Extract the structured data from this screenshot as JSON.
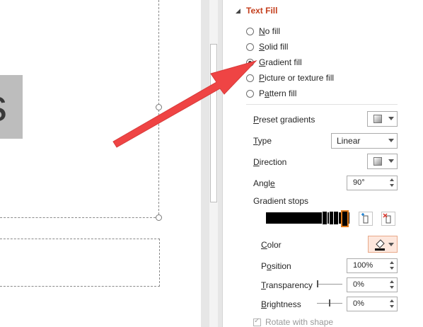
{
  "slide": {
    "partial_text": "s"
  },
  "pane": {
    "section_title": "Text Fill",
    "fill_options": [
      {
        "label": "No fill",
        "accel": "N",
        "selected": false
      },
      {
        "label": "Solid fill",
        "accel": "S",
        "selected": false
      },
      {
        "label": "Gradient fill",
        "accel": "G",
        "selected": true
      },
      {
        "label": "Picture or texture fill",
        "accel": "P",
        "selected": false
      },
      {
        "label": "Pattern fill",
        "accel": "a",
        "selected": false
      }
    ],
    "preset_gradients_label": "Preset gradients",
    "type_label": "Type",
    "type_value": "Linear",
    "direction_label": "Direction",
    "angle_label": "Angle",
    "angle_value": "90°",
    "gradient_stops_label": "Gradient stops",
    "color_label": "Color",
    "position_label": "Position",
    "position_value": "100%",
    "transparency_label": "Transparency",
    "transparency_value": "0%",
    "transparency_fraction": 0.0,
    "brightness_label": "Brightness",
    "brightness_value": "0%",
    "brightness_fraction": 0.5,
    "rotate_label": "Rotate with shape",
    "rotate_checked": true
  },
  "colors": {
    "accent": "#c43e1c",
    "arrow": "#ef4444",
    "selected_stop": "#e07a1a"
  }
}
